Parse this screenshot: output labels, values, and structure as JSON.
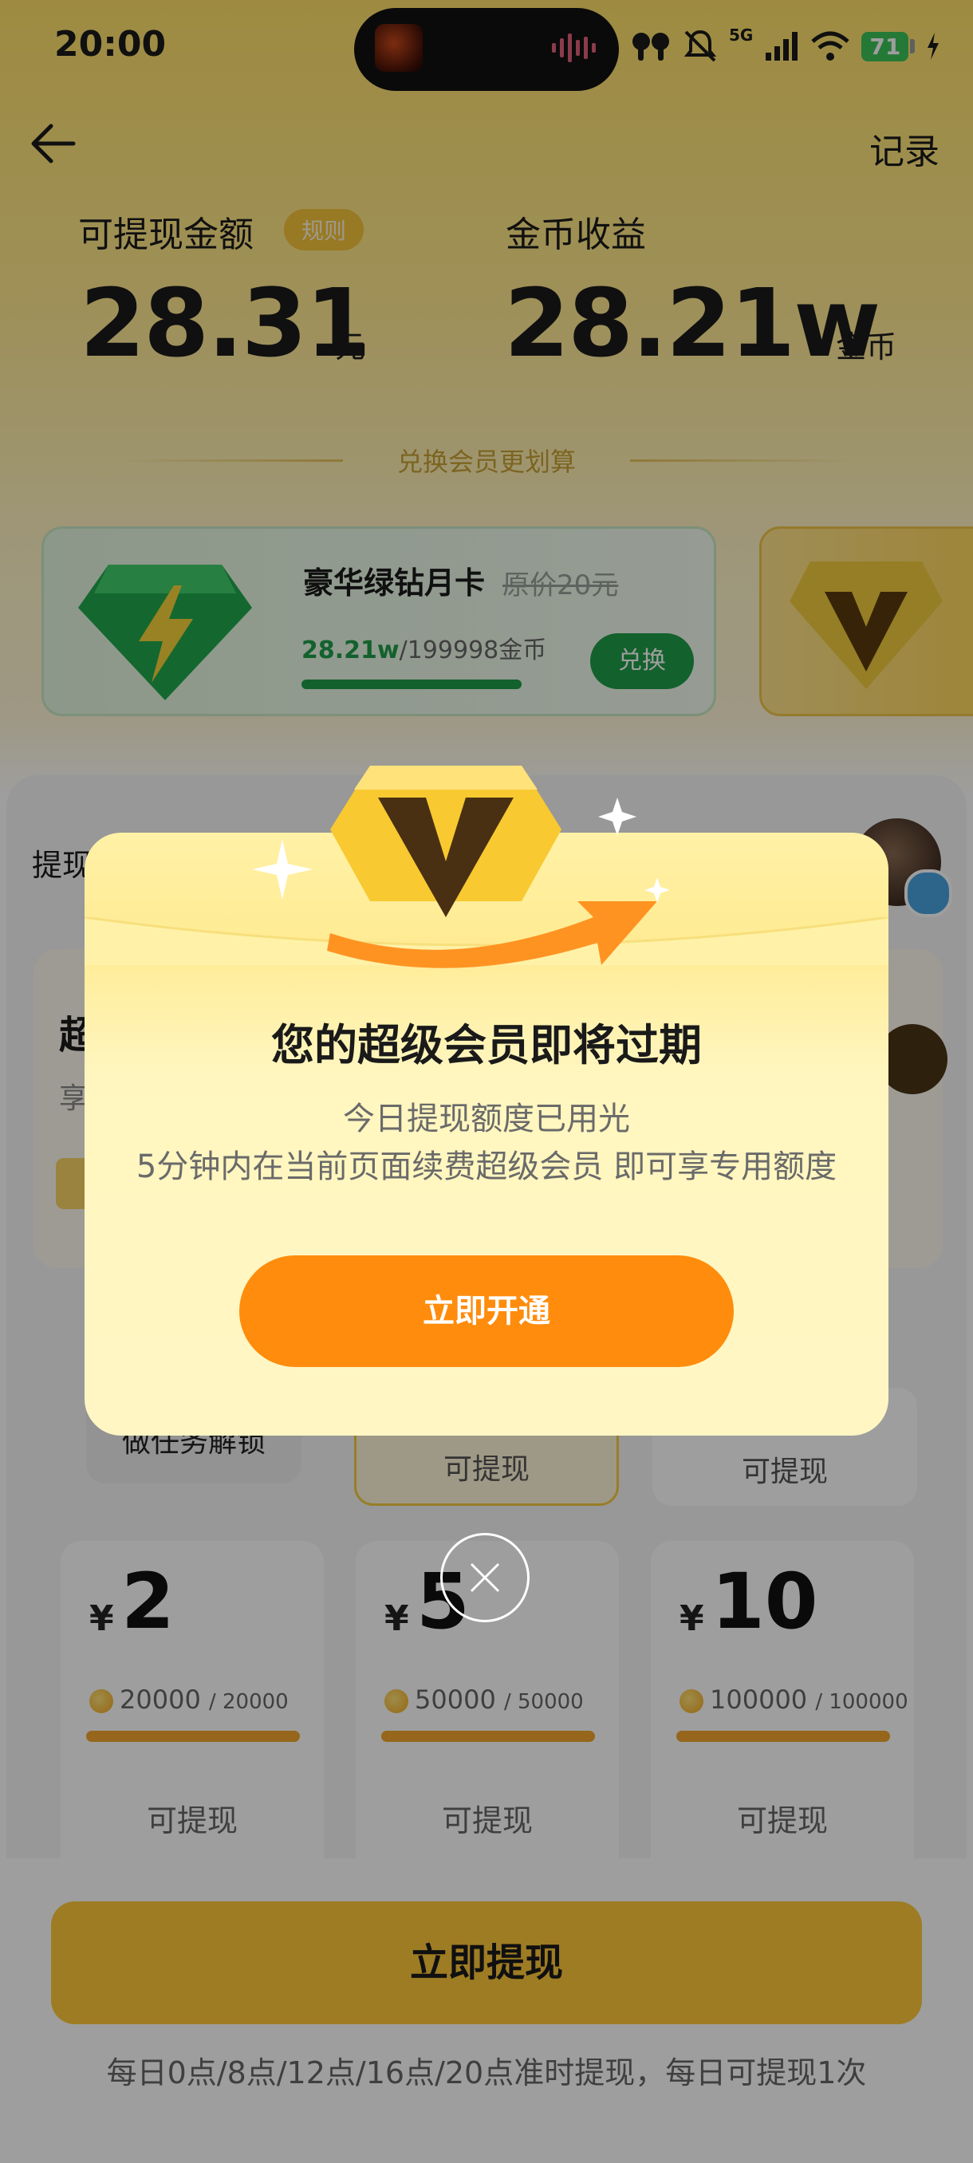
{
  "status_bar": {
    "time": "20:00",
    "network": "5G",
    "battery": "71"
  },
  "header": {
    "record_label": "记录"
  },
  "summary": {
    "balance_label": "可提现金额",
    "rules_label": "规则",
    "balance_value": "28.31",
    "balance_unit": "元",
    "coins_label": "金币收益",
    "coins_value": "28.21w",
    "coins_unit": "金币"
  },
  "exchange": {
    "title": "兑换会员更划算",
    "green_card": {
      "title": "豪华绿钻月卡",
      "original_price": "原价20元",
      "progress_current": "28.21w",
      "progress_total": "/199998金币",
      "button": "兑换"
    }
  },
  "panel": {
    "label": "提现",
    "unlock_label": "做任务解锁",
    "option2_label": "可提现",
    "option3_label": "可提现"
  },
  "withdraw_options": [
    {
      "currency": "¥",
      "amount": "2",
      "coins": "20000",
      "coins_total": "/ 20000",
      "status": "可提现",
      "progress": 1.0
    },
    {
      "currency": "¥",
      "amount": "5",
      "coins": "50000",
      "coins_total": "/ 50000",
      "status": "可提现",
      "progress": 1.0
    },
    {
      "currency": "¥",
      "amount": "10",
      "coins": "100000",
      "coins_total": "/ 100000",
      "status": "可提现",
      "progress": 1.0
    }
  ],
  "footer": {
    "withdraw_button": "立即提现",
    "note": "每日0点/8点/12点/16点/20点准时提现，每日可提现1次"
  },
  "modal": {
    "title": "您的超级会员即将过期",
    "line1": "今日提现额度已用光",
    "line2": "5分钟内在当前页面续费超级会员 即可享专用额度",
    "button": "立即开通"
  },
  "colors": {
    "accent_yellow": "#ffc83a",
    "accent_orange": "#ff8c0c",
    "accent_green": "#1f9d4a"
  }
}
